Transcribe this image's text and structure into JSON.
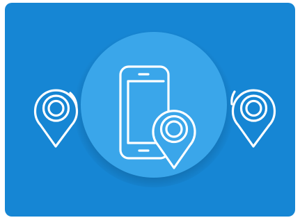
{
  "colors": {
    "card_background": "#1686d4",
    "center_circle": "#3aa6ea",
    "outline": "#ffffff"
  },
  "icons": {
    "left": "map-pin-icon",
    "center_device": "smartphone-icon",
    "center_pin": "map-pin-icon",
    "right": "map-pin-icon"
  }
}
